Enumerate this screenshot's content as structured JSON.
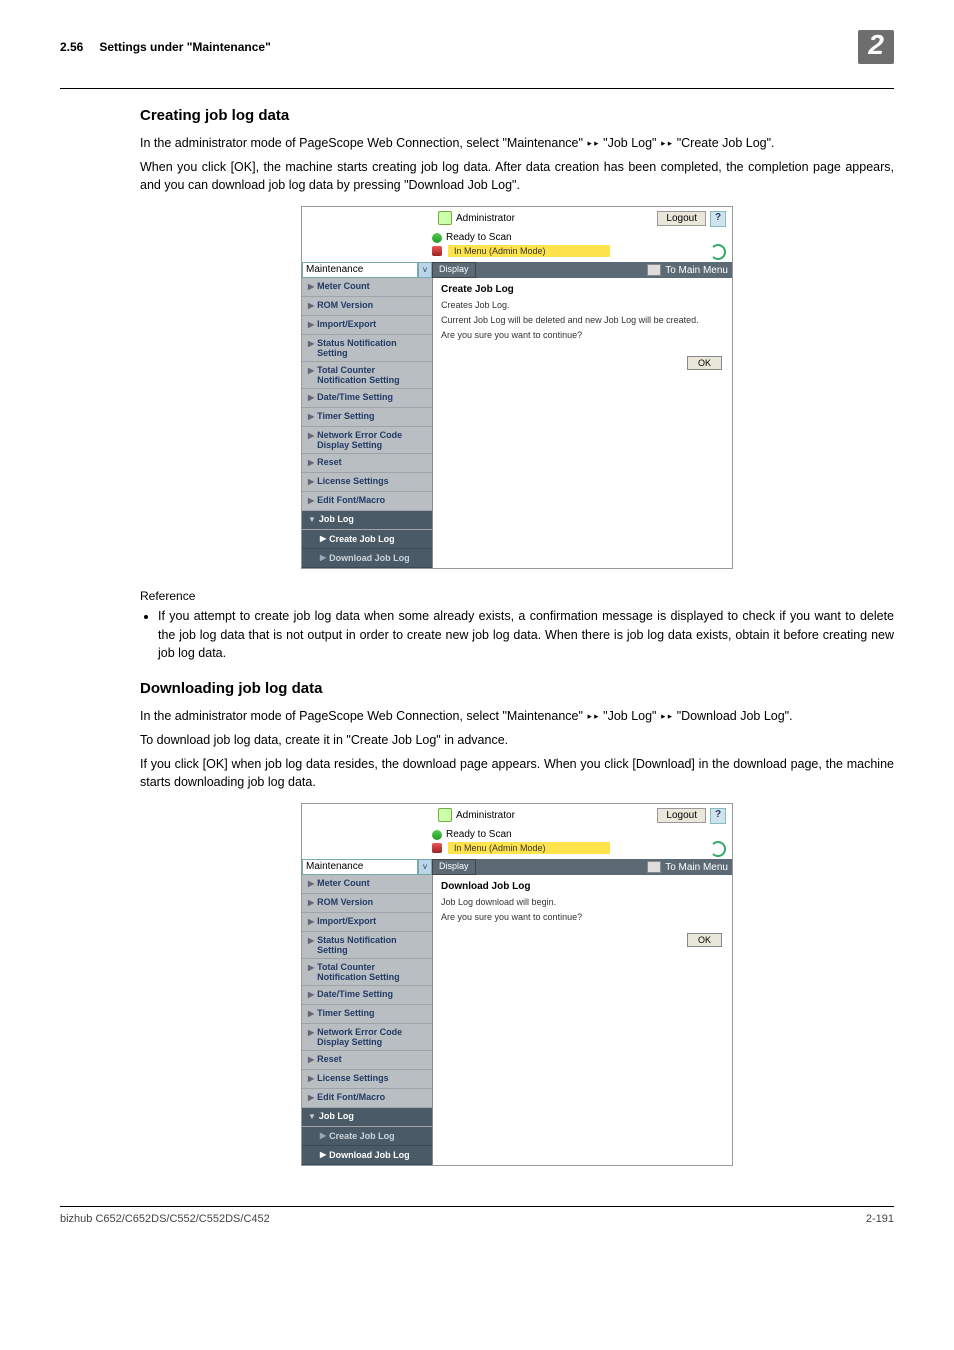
{
  "header": {
    "section_number": "2.56",
    "section_title": "Settings under \"Maintenance\"",
    "chapter_badge": "2"
  },
  "section1": {
    "title": "Creating job log data",
    "p1a": "In the administrator mode of PageScope Web Connection, select \"Maintenance\" ",
    "p1b": " \"Job Log\" ",
    "p1c": " \"Create Job Log\".",
    "arrow": "▸▸",
    "p2": "When you click [OK], the machine starts creating job log data. After data creation has been completed, the completion page appears, and you can download job log data by pressing \"Download Job Log\"."
  },
  "reference": {
    "label": "Reference",
    "item": "If you attempt to create job log data when some already exists, a confirmation message is displayed to check if you want to delete the job log data that is not output in order to create new job log data. When there is job log data exists, obtain it before creating new job log data."
  },
  "section2": {
    "title": "Downloading job log data",
    "p1a": "In the administrator mode of PageScope Web Connection, select \"Maintenance\" ",
    "p1b": " \"Job Log\" ",
    "p1c": " \"Download Job Log\".",
    "arrow": "▸▸",
    "p2": "To download job log data, create it in \"Create Job Log\" in advance.",
    "p3": "If you click [OK] when job log data resides, the download page appears. When you click [Download] in the download page, the machine starts downloading job log data."
  },
  "app": {
    "admin_label": "Administrator",
    "logout": "Logout",
    "help": "?",
    "ready": "Ready to Scan",
    "mode": "In Menu (Admin Mode)",
    "nav_select": "Maintenance",
    "display": "Display",
    "to_main": "To Main Menu",
    "sidebar": {
      "items": [
        "Meter Count",
        "ROM Version",
        "Import/Export",
        "Status Notification Setting",
        "Total Counter Notification Setting",
        "Date/Time Setting",
        "Timer Setting",
        "Network Error Code Display Setting",
        "Reset",
        "License Settings",
        "Edit Font/Macro"
      ],
      "group": "Job Log",
      "sub_create": "Create Job Log",
      "sub_download": "Download Job Log"
    },
    "pane_create": {
      "title": "Create Job Log",
      "l1": "Creates Job Log.",
      "l2": "Current Job Log will be deleted and new Job Log will be created.",
      "l3": "Are you sure you want to continue?",
      "ok": "OK"
    },
    "pane_download": {
      "title": "Download Job Log",
      "l1": "Job Log download will begin.",
      "l2": "Are you sure you want to continue?",
      "ok": "OK"
    }
  },
  "footer": {
    "product": "bizhub C652/C652DS/C552/C552DS/C452",
    "page": "2-191"
  }
}
